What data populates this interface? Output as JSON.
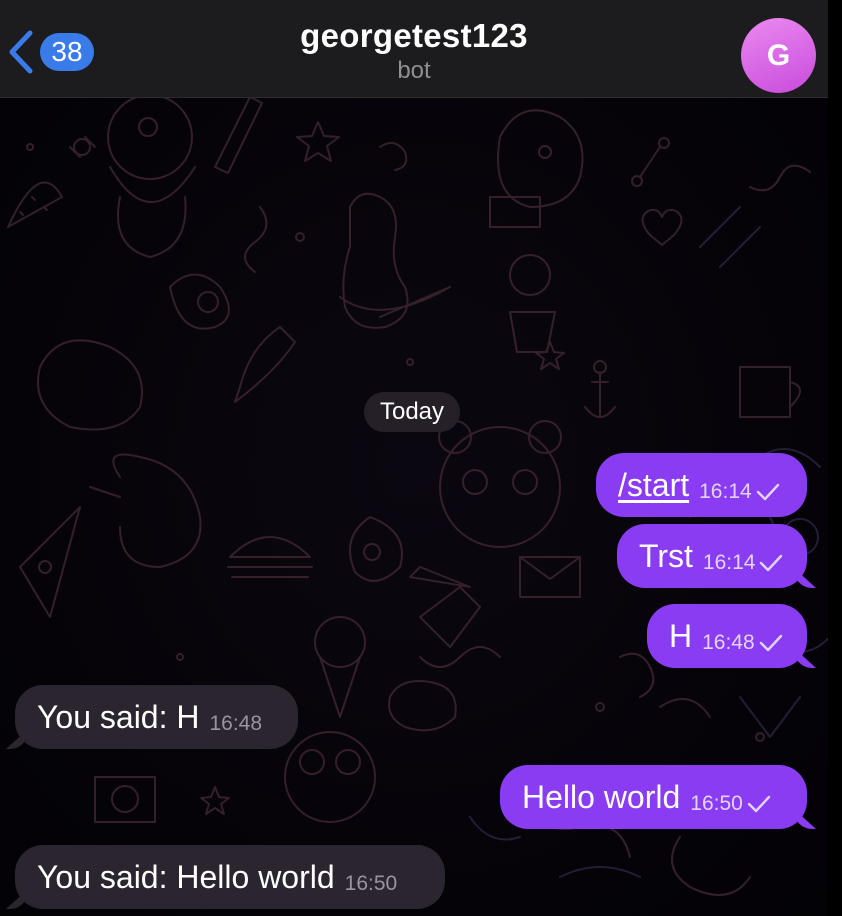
{
  "header": {
    "back_count": "38",
    "title": "georgetest123",
    "subtitle": "bot",
    "avatar_initial": "G"
  },
  "chat": {
    "date_separator": "Today",
    "messages": [
      {
        "direction": "outgoing",
        "text": "/start",
        "time": "16:14",
        "read": true,
        "is_command": true
      },
      {
        "direction": "outgoing",
        "text": "Trst",
        "time": "16:14",
        "read": true
      },
      {
        "direction": "outgoing",
        "text": "H",
        "time": "16:48",
        "read": true
      },
      {
        "direction": "incoming",
        "text": "You said: H",
        "time": "16:48"
      },
      {
        "direction": "outgoing",
        "text": "Hello world",
        "time": "16:50",
        "read": true
      },
      {
        "direction": "incoming",
        "text": "You said: Hello world",
        "time": "16:50"
      }
    ]
  },
  "colors": {
    "header_bg": "#1c1c1e",
    "accent_blue": "#3a7bea",
    "outgoing_bubble": "#8a3cf2",
    "incoming_bubble": "#2b2530",
    "avatar_gradient": [
      "#ea8af0",
      "#c94bdc"
    ]
  },
  "icons": {
    "back": "chevron-left-icon",
    "read_receipt": "checkmark-icon"
  }
}
